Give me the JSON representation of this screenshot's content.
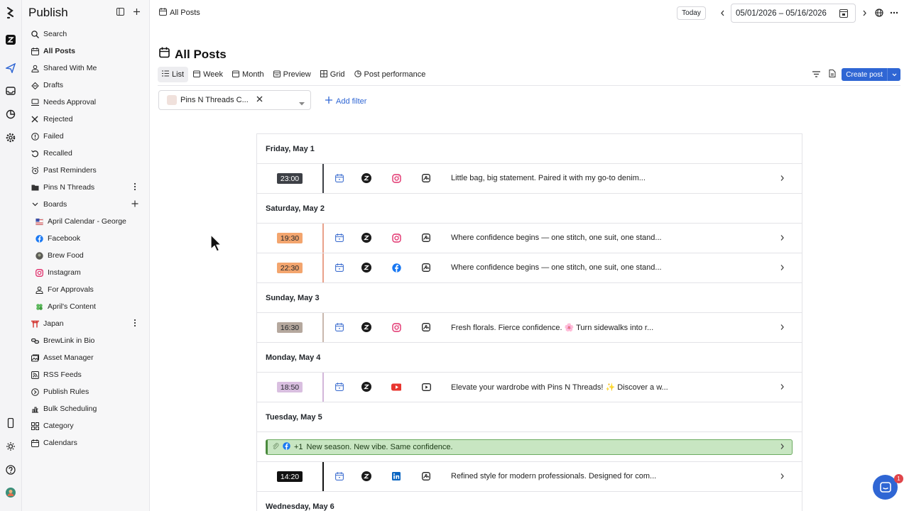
{
  "sidebar": {
    "title": "Publish",
    "items": [
      {
        "label": "Search",
        "icon": "search-icon"
      },
      {
        "label": "All Posts",
        "icon": "calendar-icon",
        "active": true
      },
      {
        "label": "Shared With Me",
        "icon": "user-icon"
      },
      {
        "label": "Drafts",
        "icon": "drafts-icon"
      },
      {
        "label": "Needs Approval",
        "icon": "approval-icon"
      },
      {
        "label": "Rejected",
        "icon": "x-icon"
      },
      {
        "label": "Failed",
        "icon": "alert-icon"
      },
      {
        "label": "Recalled",
        "icon": "recall-icon"
      },
      {
        "label": "Past Reminders",
        "icon": "alarm-icon"
      },
      {
        "label": "Pins N Threads",
        "icon": "folder-icon"
      },
      {
        "label": "Boards",
        "icon": "chevron-down-icon"
      },
      {
        "label": "April Calendar - George",
        "icon": "flag-icon"
      },
      {
        "label": "Facebook",
        "icon": "facebook-icon"
      },
      {
        "label": "Brew Food",
        "icon": "avatar-icon"
      },
      {
        "label": "Instagram",
        "icon": "instagram-icon"
      },
      {
        "label": "For Approvals",
        "icon": "user-icon"
      },
      {
        "label": "April's Content",
        "icon": "clover-icon"
      },
      {
        "label": "Japan",
        "icon": "torii-icon"
      },
      {
        "label": "BrewLink in Bio",
        "icon": "link-icon"
      },
      {
        "label": "Asset Manager",
        "icon": "asset-icon"
      },
      {
        "label": "RSS Feeds",
        "icon": "rss-icon"
      },
      {
        "label": "Publish Rules",
        "icon": "rules-icon"
      },
      {
        "label": "Bulk Scheduling",
        "icon": "bulk-icon"
      },
      {
        "label": "Category",
        "icon": "grid-icon"
      },
      {
        "label": "Calendars",
        "icon": "calendar-icon"
      }
    ]
  },
  "topbar": {
    "breadcrumb": "All Posts",
    "today_label": "Today",
    "date_range": "05/01/2026  – 05/16/2026"
  },
  "page": {
    "title": "All Posts",
    "tabs": [
      "List",
      "Week",
      "Month",
      "Preview",
      "Grid",
      "Post performance"
    ],
    "create_label": "Create post",
    "filter_chip": "Pins N Threads C...",
    "add_filter": "Add filter"
  },
  "days": [
    {
      "label": "Friday, May 1",
      "rows": [
        {
          "time": "23:00",
          "time_bg": "#3d4046",
          "time_fg": "#ffffff",
          "bar": "#3d4046",
          "network": "instagram",
          "text": "Little bag, big statement. Paired it with my go-to denim..."
        }
      ]
    },
    {
      "label": "Saturday, May 2",
      "rows": [
        {
          "time": "19:30",
          "time_bg": "#f3a56e",
          "time_fg": "#1f2328",
          "bar": "#e9a18a",
          "network": "instagram",
          "text": "Where confidence begins — one stitch, one suit, one stand..."
        },
        {
          "time": "22:30",
          "time_bg": "#f3a56e",
          "time_fg": "#1f2328",
          "bar": "#e9a18a",
          "network": "facebook",
          "text": "Where confidence begins — one stitch, one suit, one stand..."
        }
      ]
    },
    {
      "label": "Sunday, May 3",
      "rows": [
        {
          "time": "16:30",
          "time_bg": "#b5a89e",
          "time_fg": "#1f2328",
          "bar": "#c9b8ad",
          "network": "instagram",
          "text": "Fresh florals. Fierce confidence. 🌸 Turn sidewalks into r..."
        }
      ]
    },
    {
      "label": "Monday, May 4",
      "rows": [
        {
          "time": "18:50",
          "time_bg": "#d9bfe0",
          "time_fg": "#1f2328",
          "bar": "#d3b6da",
          "network": "youtube",
          "text": "Elevate your wardrobe with Pins N Threads! ✨ Discover a w..."
        }
      ]
    },
    {
      "label": "Tuesday, May 5",
      "green": {
        "count": "+1",
        "text": "New season. New vibe. Same confidence."
      },
      "rows": [
        {
          "time": "14:20",
          "time_bg": "#111111",
          "time_fg": "#ffffff",
          "bar": "#111111",
          "network": "linkedin",
          "text": "Refined style for modern professionals. Designed for com..."
        }
      ]
    },
    {
      "label": "Wednesday, May 6",
      "rows": []
    }
  ],
  "help": {
    "badge": "1"
  }
}
